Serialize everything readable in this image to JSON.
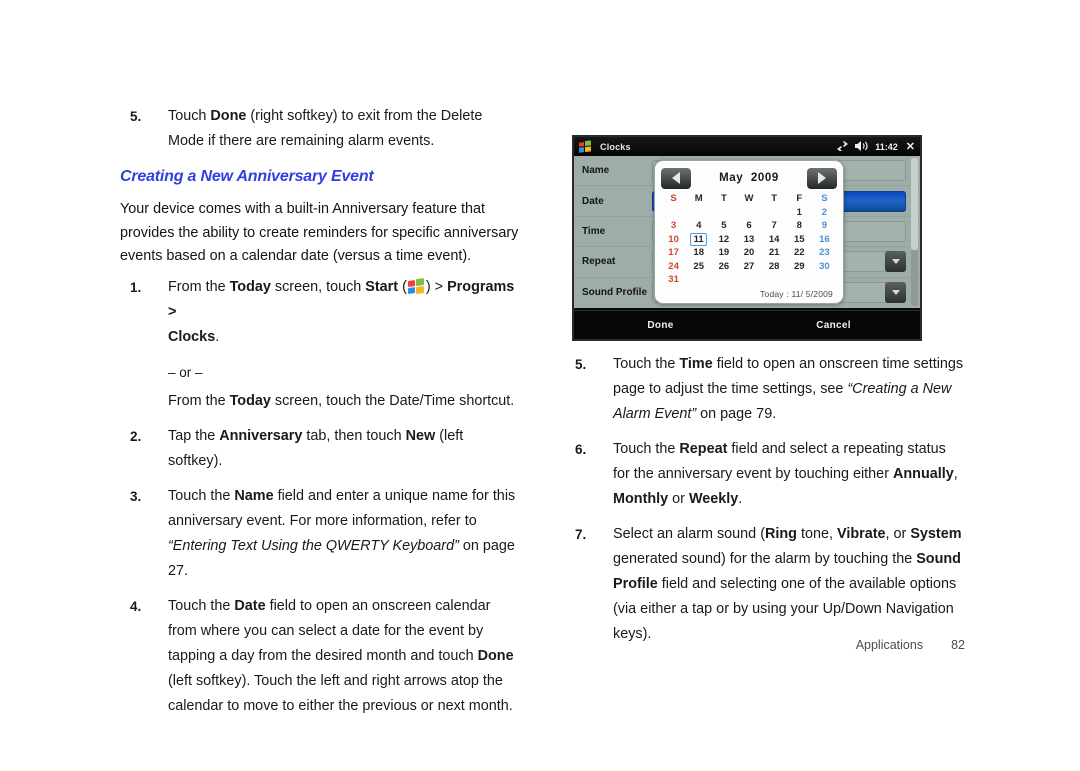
{
  "left_column": {
    "step5": {
      "num": "5.",
      "text_1": "Touch ",
      "bold_1": "Done",
      "text_2": " (right softkey) to exit from the Delete Mode if there are remaining alarm events."
    },
    "heading": "Creating a New Anniversary Event",
    "intro": "Your device comes with a built-in Anniversary feature that provides the ability to create reminders for specific anniversary events based on a calendar date (versus a time event).",
    "step1": {
      "num": "1.",
      "text_1": "From the ",
      "bold_1": "Today",
      "text_2": " screen, touch ",
      "bold_2": "Start",
      "text_3": " (",
      "icon": "windows-logo-icon",
      "text_4": ") > ",
      "bold_3": "Programs >",
      "bold_4": "Clocks",
      "text_5": "."
    },
    "or_divider": "– or –",
    "or_line": {
      "text_1": "From the ",
      "bold_1": "Today",
      "text_2": " screen, touch the Date/Time shortcut."
    },
    "step2": {
      "num": "2.",
      "text_1": "Tap the ",
      "bold_1": "Anniversary",
      "text_2": " tab, then touch ",
      "bold_2": "New",
      "text_3": " (left softkey)."
    },
    "step3": {
      "num": "3.",
      "text_1": "Touch the ",
      "bold_1": "Name",
      "text_2": " field and enter a unique name for this anniversary event. For more information, refer to ",
      "italic_1": "“Entering Text Using the QWERTY Keyboard”",
      "text_3": " on page 27."
    },
    "step4": {
      "num": "4.",
      "text_1": "Touch the ",
      "bold_1": "Date",
      "text_2": " field to open an onscreen calendar from where you can select a date for the event by tapping a day from the desired month and touch ",
      "bold_2": "Done",
      "text_3": " (left softkey). Touch the left and right arrows atop the calendar to move to either the previous or next month."
    }
  },
  "right_column": {
    "step5": {
      "num": "5.",
      "text_1": "Touch the ",
      "bold_1": "Time",
      "text_2": " field to open an onscreen time settings page to adjust the time settings, see ",
      "italic_1": "“Creating a New Alarm Event”",
      "text_3": " on page 79."
    },
    "step6": {
      "num": "6.",
      "text_1": "Touch the ",
      "bold_1": "Repeat",
      "text_2": " field and select a repeating status for the anniversary event by touching either ",
      "bold_2": "Annually",
      "text_3": ", ",
      "bold_3": "Monthly",
      "text_4": " or ",
      "bold_4": "Weekly",
      "text_5": "."
    },
    "step7": {
      "num": "7.",
      "text_1": "Select an alarm sound (",
      "bold_1": "Ring",
      "text_2": " tone, ",
      "bold_2": "Vibrate",
      "text_3": ", or ",
      "bold_3": "System",
      "text_4": " generated sound) for the alarm by touching the ",
      "bold_4": "Sound Profile",
      "text_5": " field and selecting one of the available options (via either a tap or by using your Up/Down Navigation keys)."
    }
  },
  "device": {
    "titlebar": {
      "app_icon": "windows-flag-icon",
      "app_title": "Clocks",
      "connection_icon": "connectivity-icon",
      "volume_icon": "speaker-icon",
      "clock": "11:42",
      "close_icon": "✕"
    },
    "form_rows": [
      {
        "label": "Name",
        "type": "text"
      },
      {
        "label": "Date",
        "type": "text-selected"
      },
      {
        "label": "Time",
        "type": "text"
      },
      {
        "label": "Repeat",
        "type": "dropdown"
      },
      {
        "label": "Sound Profile",
        "type": "dropdown"
      }
    ],
    "calendar": {
      "prev_icon": "arrow-left-icon",
      "next_icon": "arrow-right-icon",
      "month": "May",
      "year": "2009",
      "weekday_headers": [
        "S",
        "M",
        "T",
        "W",
        "T",
        "F",
        "S"
      ],
      "weeks": [
        [
          "",
          "",
          "",
          "",
          "",
          "1",
          "2"
        ],
        [
          "3",
          "4",
          "5",
          "6",
          "7",
          "8",
          "9"
        ],
        [
          "10",
          "11",
          "12",
          "13",
          "14",
          "15",
          "16"
        ],
        [
          "17",
          "18",
          "19",
          "20",
          "21",
          "22",
          "23"
        ],
        [
          "24",
          "25",
          "26",
          "27",
          "28",
          "29",
          "30"
        ],
        [
          "31",
          "",
          "",
          "",
          "",
          "",
          ""
        ]
      ],
      "selected_day": "11",
      "today_label": "Today : 11/ 5/2009"
    },
    "softkeys": {
      "left": "Done",
      "right": "Cancel"
    }
  },
  "footer": {
    "section": "Applications",
    "page_number": "82"
  },
  "colors": {
    "heading_blue": "#2f3fe0",
    "device_form_bg": "#9fada9",
    "selected_field_blue": "#1d64c8",
    "sunday_red": "#d4442a",
    "saturday_blue": "#4a8fd8"
  }
}
